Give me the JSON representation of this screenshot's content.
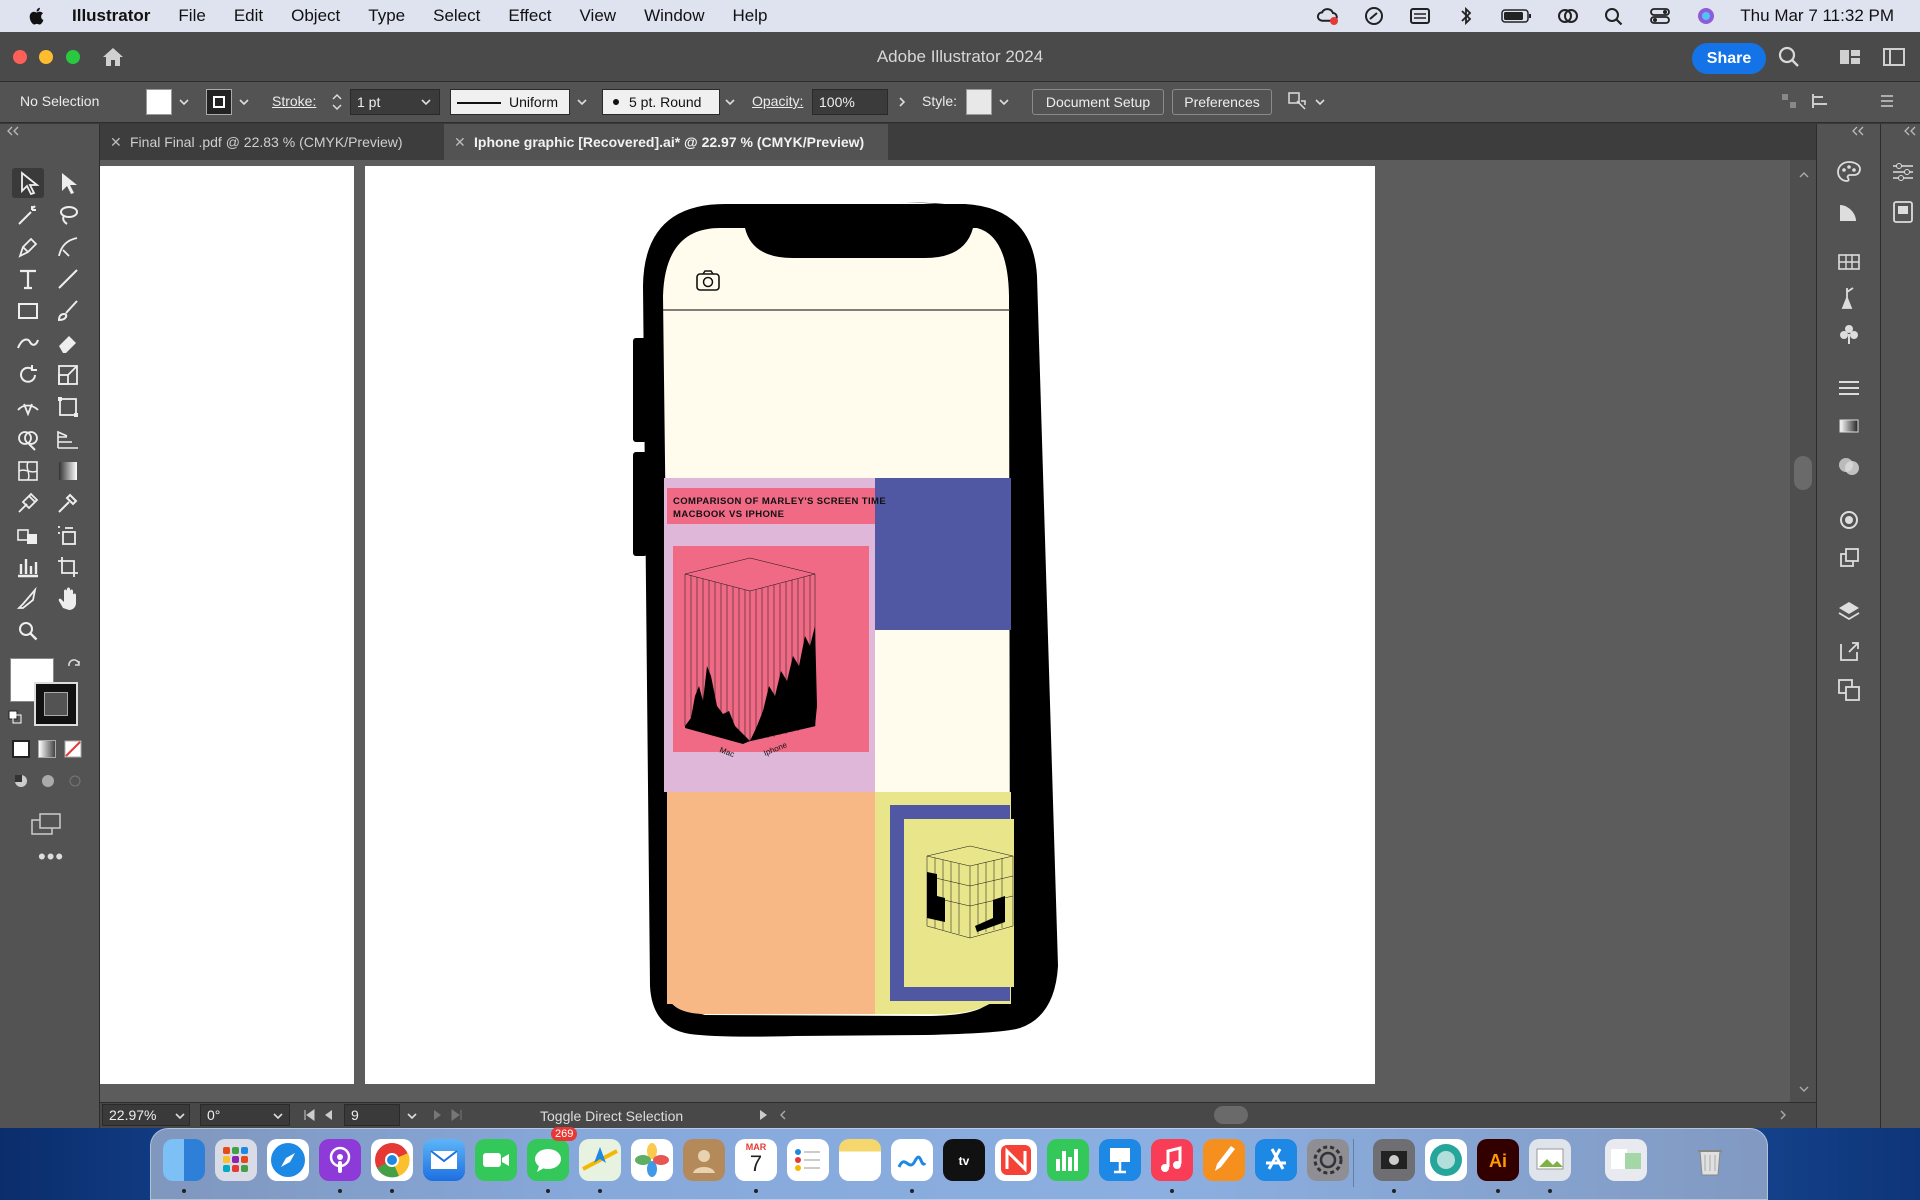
{
  "menubar": {
    "app": "Illustrator",
    "items": [
      "File",
      "Edit",
      "Object",
      "Type",
      "Select",
      "Effect",
      "View",
      "Window",
      "Help"
    ],
    "datetime": "Thu Mar 7  11:32 PM"
  },
  "titlebar": {
    "title": "Adobe Illustrator 2024",
    "share": "Share"
  },
  "controlbar": {
    "selection": "No Selection",
    "stroke_label": "Stroke:",
    "stroke_value": "1 pt",
    "profile": "Uniform",
    "brush": "5 pt. Round",
    "opacity_label": "Opacity:",
    "opacity_value": "100%",
    "style_label": "Style:",
    "doc_setup": "Document Setup",
    "preferences": "Preferences"
  },
  "tabs": [
    {
      "label": "Final Final .pdf @ 22.83 % (CMYK/Preview)"
    },
    {
      "label": "Iphone graphic [Recovered].ai* @ 22.97 % (CMYK/Preview)"
    }
  ],
  "artwork": {
    "poster_title_line1": "COMPARISON OF MARLEY'S SCREEN TIME",
    "poster_title_line2": "MACBOOK VS IPHONE",
    "axis_mac": "Mac",
    "axis_iphone": "Iphone",
    "colors": {
      "screen": "#fffcee",
      "lavender": "#dfb7d8",
      "pink": "#f06a86",
      "blue": "#5158a3",
      "peach": "#f8b885",
      "yellow": "#e8e58a"
    }
  },
  "statusbar": {
    "zoom": "22.97%",
    "rotation": "0°",
    "artboard": "9",
    "hint": "Toggle Direct Selection"
  },
  "dock": {
    "messages_badge": "269",
    "calendar_month": "MAR",
    "calendar_day": "7",
    "apps": [
      "finder-icon",
      "launchpad-icon",
      "safari-icon",
      "podcasts-icon",
      "chrome-icon",
      "mail-icon",
      "facetime-icon",
      "messages-icon",
      "maps-icon",
      "photos-icon",
      "contacts-icon",
      "calendar-icon",
      "reminders-icon",
      "notes-icon",
      "freeform-icon",
      "appletv-icon",
      "news-icon",
      "numbers-icon",
      "keynote-icon",
      "music-icon",
      "pages-icon",
      "appstore-icon",
      "settings-icon",
      "screenshot-icon",
      "browser-icon",
      "illustrator-icon",
      "preview-icon",
      "downloads-icon",
      "trash-icon"
    ]
  }
}
